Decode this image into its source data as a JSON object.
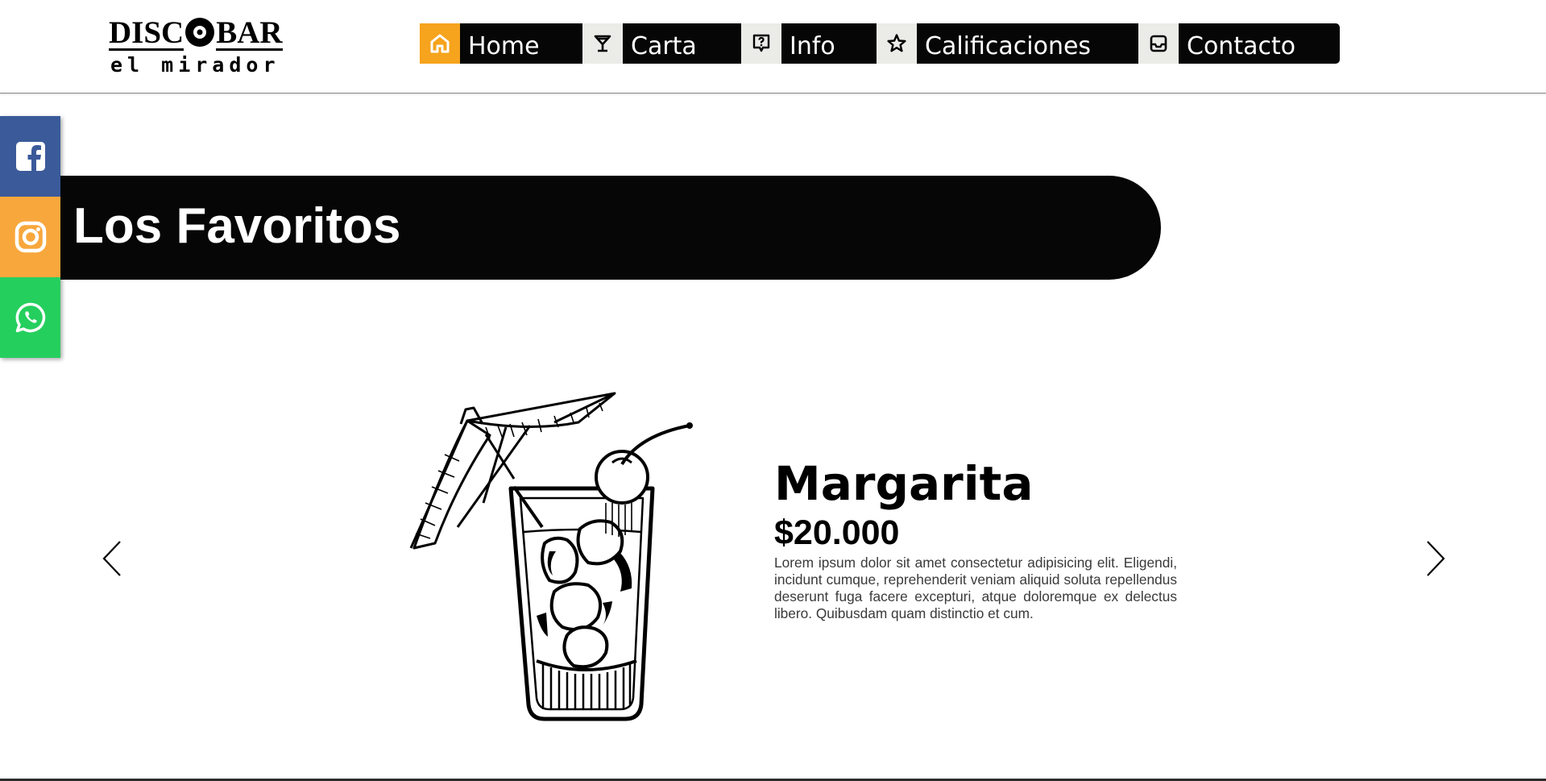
{
  "logo": {
    "top_left": "DISC",
    "top_right": "BAR",
    "bottom": "el mirador"
  },
  "nav": {
    "items": [
      {
        "label": "Home",
        "icon": "home-icon",
        "active": true
      },
      {
        "label": "Carta",
        "icon": "cocktail-glass-icon",
        "active": false
      },
      {
        "label": "Info",
        "icon": "question-bubble-icon",
        "active": false
      },
      {
        "label": "Calificaciones",
        "icon": "star-icon",
        "active": false
      },
      {
        "label": "Contacto",
        "icon": "inbox-icon",
        "active": false
      }
    ]
  },
  "social": [
    {
      "name": "facebook",
      "icon": "facebook-icon",
      "color": "#3b5a9a"
    },
    {
      "name": "instagram",
      "icon": "instagram-icon",
      "color": "#f8a73d"
    },
    {
      "name": "whatsapp",
      "icon": "whatsapp-icon",
      "color": "#25cf5e"
    }
  ],
  "section": {
    "title": "Los Favoritos"
  },
  "slide": {
    "name": "Margarita",
    "price": "$20.000",
    "description": "Lorem ipsum dolor sit amet consectetur adipisicing elit. Eligendi, incidunt cumque, reprehenderit veniam aliquid soluta repellendus deserunt fuga facere excepturi, atque doloremque ex delectus libero. Quibusdam quam distinctio et cum.",
    "image_icon": "cocktail-umbrella-illustration"
  },
  "colors": {
    "accent": "#f6a31d",
    "nav_bg": "#060606",
    "icon_bg": "#ebebe8"
  }
}
